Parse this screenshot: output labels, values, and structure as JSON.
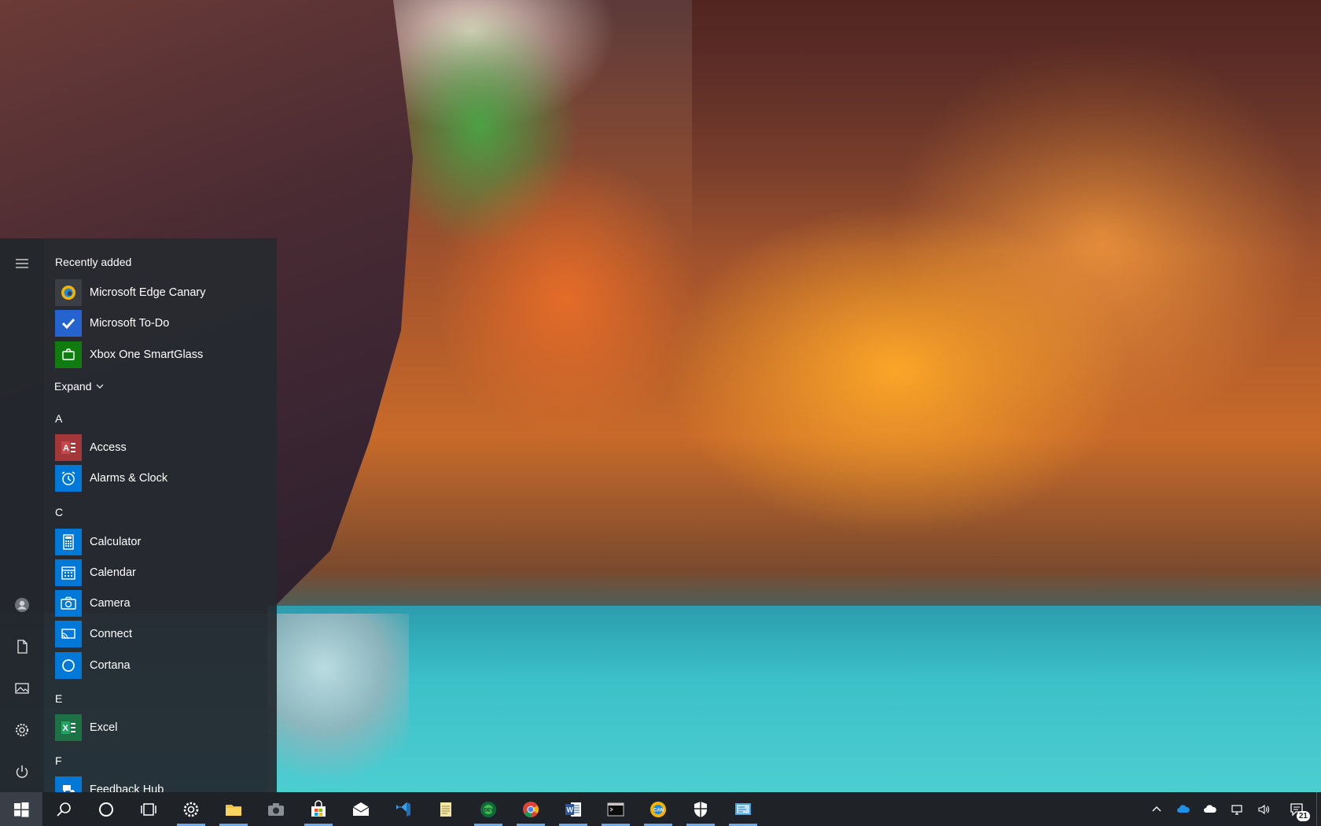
{
  "start_menu": {
    "recently_added": {
      "header": "Recently added",
      "items": [
        {
          "label": "Microsoft Edge Canary",
          "icon": "edge-canary-icon"
        },
        {
          "label": "Microsoft To-Do",
          "icon": "todo-check-icon"
        },
        {
          "label": "Xbox One SmartGlass",
          "icon": "xbox-smartglass-icon"
        }
      ],
      "expand_label": "Expand"
    },
    "sections": [
      {
        "letter": "A",
        "apps": [
          {
            "label": "Access",
            "icon": "access-icon"
          },
          {
            "label": "Alarms & Clock",
            "icon": "alarm-clock-icon"
          }
        ]
      },
      {
        "letter": "C",
        "apps": [
          {
            "label": "Calculator",
            "icon": "calculator-icon"
          },
          {
            "label": "Calendar",
            "icon": "calendar-icon"
          },
          {
            "label": "Camera",
            "icon": "camera-icon"
          },
          {
            "label": "Connect",
            "icon": "connect-icon"
          },
          {
            "label": "Cortana",
            "icon": "cortana-icon"
          }
        ]
      },
      {
        "letter": "E",
        "apps": [
          {
            "label": "Excel",
            "icon": "excel-icon"
          }
        ]
      },
      {
        "letter": "F",
        "apps": [
          {
            "label": "Feedback Hub",
            "icon": "feedback-hub-icon"
          }
        ]
      }
    ],
    "rail": [
      "hamburger-menu-icon",
      "user-avatar-icon",
      "documents-icon",
      "pictures-icon",
      "settings-icon",
      "power-icon"
    ]
  },
  "taskbar": {
    "pinned": [
      "start-icon",
      "search-icon",
      "cortana-circle-icon",
      "task-view-icon",
      "settings-icon",
      "file-explorer-icon",
      "camera-icon",
      "store-icon",
      "mail-icon",
      "visual-studio-icon",
      "notepad-icon",
      "edge-dev-icon",
      "chrome-icon",
      "word-icon",
      "terminal-icon",
      "edge-canary-icon",
      "security-shield-icon",
      "remote-desktop-icon"
    ],
    "tray": [
      "chevron-up-icon",
      "onedrive-icon",
      "onedrive-personal-icon",
      "network-icon",
      "volume-icon"
    ],
    "notification_count": "21"
  },
  "colors": {
    "menu_bg": "#262a30",
    "taskbar_bg": "#1f2227",
    "accent": "#0078d7",
    "access_red": "#a4373a",
    "excel_green": "#1e7145",
    "xbox_green": "#107c10"
  }
}
